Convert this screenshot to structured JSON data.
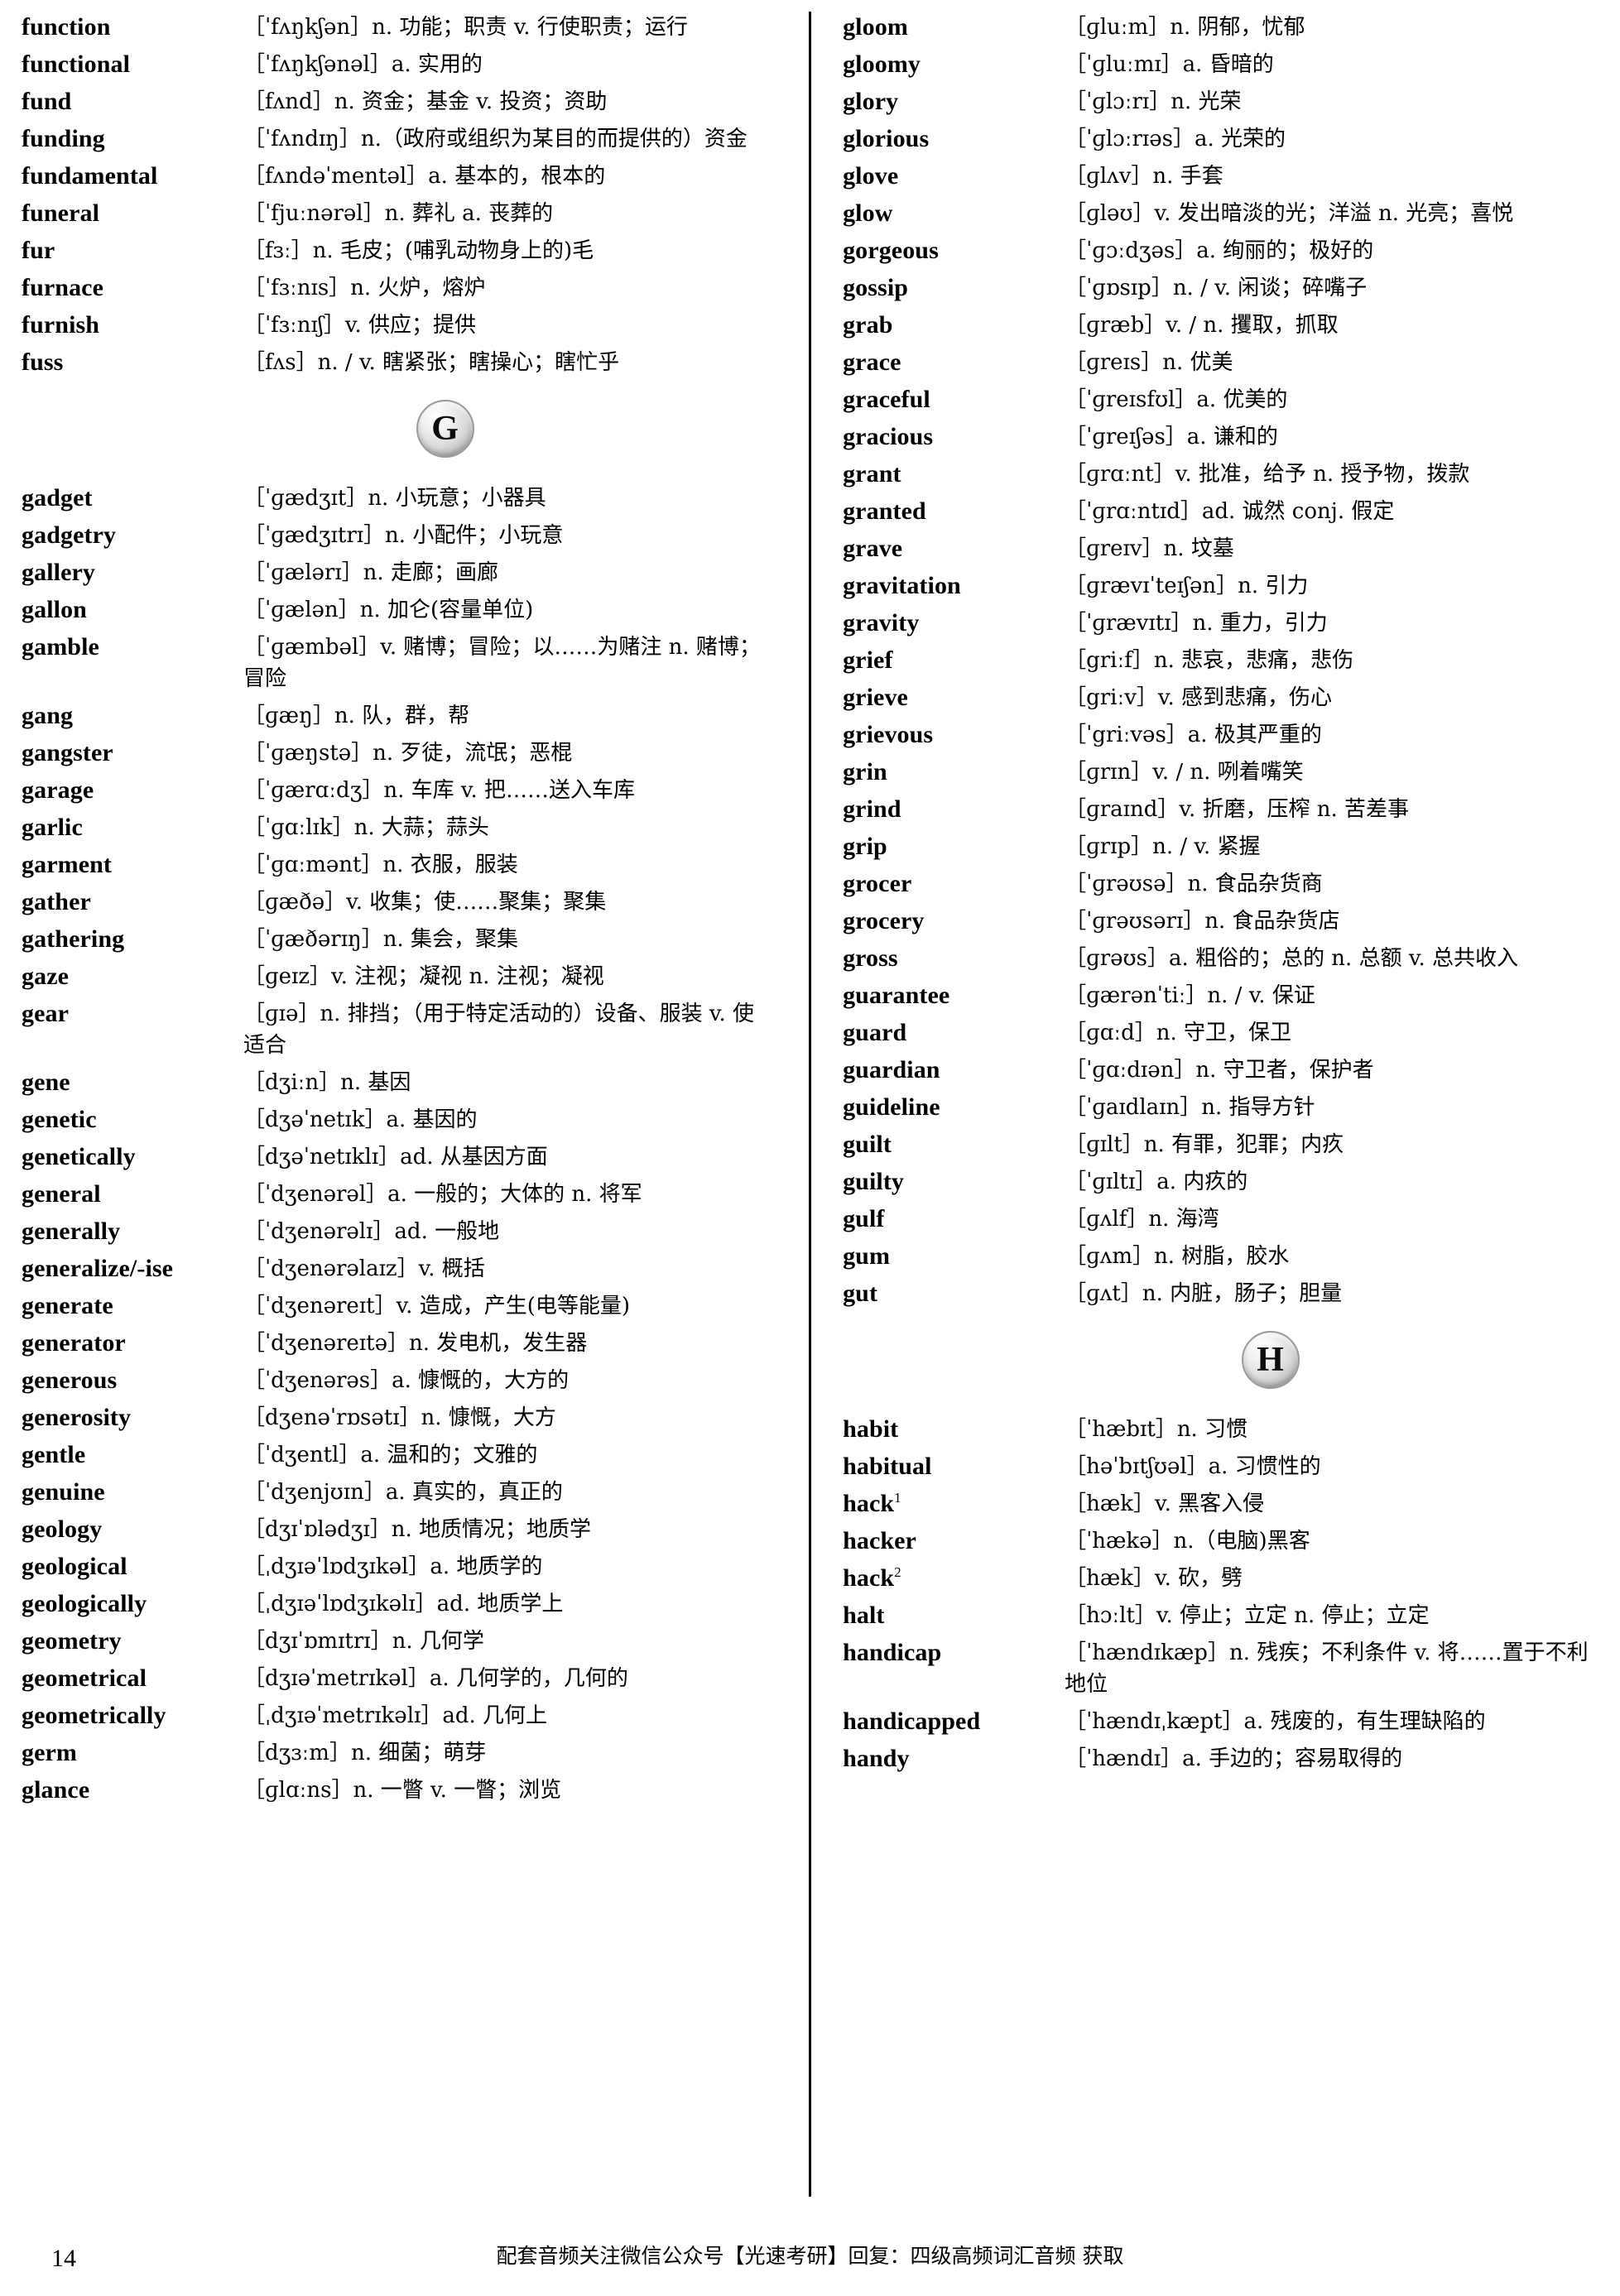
{
  "page": {
    "number": "14",
    "footer_note": "配套音频关注微信公众号【光速考研】回复：四级高频词汇音频 获取"
  },
  "left_column": {
    "entries": [
      {
        "word": "function",
        "sense": "［ˈfʌŋkʃən］n. 功能；职责 v. 行使职责；运行"
      },
      {
        "word": "functional",
        "sense": "［ˈfʌŋkʃənəl］a. 实用的"
      },
      {
        "word": "fund",
        "sense": "［fʌnd］n. 资金；基金 v. 投资；资助"
      },
      {
        "word": "funding",
        "sense": "［ˈfʌndɪŋ］n.（政府或组织为某目的而提供的）资金"
      },
      {
        "word": "fundamental",
        "sense": "［fʌndəˈmentəl］a. 基本的，根本的"
      },
      {
        "word": "funeral",
        "sense": "［ˈfjuːnərəl］n. 葬礼 a. 丧葬的"
      },
      {
        "word": "fur",
        "sense": "［fɜː］n. 毛皮；(哺乳动物身上的)毛"
      },
      {
        "word": "furnace",
        "sense": "［ˈfɜːnɪs］n. 火炉，熔炉"
      },
      {
        "word": "furnish",
        "sense": "［ˈfɜːnɪʃ］v. 供应；提供"
      },
      {
        "word": "fuss",
        "sense": "［fʌs］n. / v. 瞎紧张；瞎操心；瞎忙乎"
      }
    ],
    "letter_separator": "G",
    "entries_after": [
      {
        "word": "gadget",
        "sense": "［ˈɡædʒɪt］n. 小玩意；小器具"
      },
      {
        "word": "gadgetry",
        "sense": "［ˈɡædʒɪtrɪ］n. 小配件；小玩意"
      },
      {
        "word": "gallery",
        "sense": "［ˈɡælərɪ］n. 走廊；画廊"
      },
      {
        "word": "gallon",
        "sense": "［ˈɡælən］n. 加仑(容量单位)"
      },
      {
        "word": "gamble",
        "sense": "［ˈɡæmbəl］v. 赌博；冒险；以……为赌注 n. 赌博；冒险"
      },
      {
        "word": "gang",
        "sense": "［ɡæŋ］n. 队，群，帮"
      },
      {
        "word": "gangster",
        "sense": "［ˈɡæŋstə］n. 歹徒，流氓；恶棍"
      },
      {
        "word": "garage",
        "sense": "［ˈɡærɑːdʒ］n. 车库 v. 把……送入车库"
      },
      {
        "word": "garlic",
        "sense": "［ˈɡɑːlɪk］n. 大蒜；蒜头"
      },
      {
        "word": "garment",
        "sense": "［ˈɡɑːmənt］n. 衣服，服装"
      },
      {
        "word": "gather",
        "sense": "［ɡæðə］v. 收集；使……聚集；聚集"
      },
      {
        "word": "gathering",
        "sense": "［ˈɡæðərɪŋ］n. 集会，聚集"
      },
      {
        "word": "gaze",
        "sense": "［ɡeɪz］v. 注视；凝视 n. 注视；凝视"
      },
      {
        "word": "gear",
        "sense": "［ɡɪə］n. 排挡；（用于特定活动的）设备、服装 v. 使适合"
      },
      {
        "word": "gene",
        "sense": "［dʒiːn］n. 基因"
      },
      {
        "word": "genetic",
        "sense": "［dʒəˈnetɪk］a. 基因的"
      },
      {
        "word": "genetically",
        "sense": "［dʒəˈnetɪklɪ］ad. 从基因方面"
      },
      {
        "word": "general",
        "sense": "［ˈdʒenərəl］a. 一般的；大体的 n. 将军"
      },
      {
        "word": "generally",
        "sense": "［ˈdʒenərəlɪ］ad. 一般地"
      },
      {
        "word": "generalize/-ise",
        "sense": "［ˈdʒenərəlaɪz］v. 概括"
      },
      {
        "word": "generate",
        "sense": "［ˈdʒenəreɪt］v. 造成，产生(电等能量)"
      },
      {
        "word": "generator",
        "sense": "［ˈdʒenəreɪtə］n. 发电机，发生器"
      },
      {
        "word": "generous",
        "sense": "［ˈdʒenərəs］a. 慷慨的，大方的"
      },
      {
        "word": "generosity",
        "sense": "［dʒenəˈrɒsətɪ］n. 慷慨，大方"
      },
      {
        "word": "gentle",
        "sense": "［ˈdʒentl］a. 温和的；文雅的"
      },
      {
        "word": "genuine",
        "sense": "［ˈdʒenjʊɪn］a. 真实的，真正的"
      },
      {
        "word": "geology",
        "sense": "［dʒɪˈɒlədʒɪ］n. 地质情况；地质学"
      },
      {
        "word": "geological",
        "sense": "［ˌdʒɪəˈlɒdʒɪkəl］a. 地质学的"
      },
      {
        "word": "geologically",
        "sense": "［ˌdʒɪəˈlɒdʒɪkəlɪ］ad. 地质学上"
      },
      {
        "word": "geometry",
        "sense": "［dʒɪˈɒmɪtrɪ］n. 几何学"
      },
      {
        "word": "geometrical",
        "sense": "［dʒɪəˈmetrɪkəl］a. 几何学的，几何的"
      },
      {
        "word": "geometrically",
        "sense": "［ˌdʒɪəˈmetrɪkəlɪ］ad. 几何上"
      },
      {
        "word": "germ",
        "sense": "［dʒɜːm］n. 细菌；萌芽"
      },
      {
        "word": "glance",
        "sense": "［ɡlɑːns］n. 一瞥 v. 一瞥；浏览"
      }
    ]
  },
  "right_column": {
    "entries": [
      {
        "word": "gloom",
        "sense": "［ɡluːm］n. 阴郁，忧郁"
      },
      {
        "word": "gloomy",
        "sense": "［ˈɡluːmɪ］a. 昏暗的"
      },
      {
        "word": "glory",
        "sense": "［ˈɡlɔːrɪ］n. 光荣"
      },
      {
        "word": "glorious",
        "sense": "［ˈɡlɔːrɪəs］a. 光荣的"
      },
      {
        "word": "glove",
        "sense": "［ɡlʌv］n. 手套"
      },
      {
        "word": "glow",
        "sense": "［ɡləʊ］v. 发出暗淡的光；洋溢 n. 光亮；喜悦"
      },
      {
        "word": "gorgeous",
        "sense": "［ˈɡɔːdʒəs］a. 绚丽的；极好的"
      },
      {
        "word": "gossip",
        "sense": "［ˈɡɒsɪp］n. / v. 闲谈；碎嘴子"
      },
      {
        "word": "grab",
        "sense": "［ɡræb］v. / n. 攫取，抓取"
      },
      {
        "word": "grace",
        "sense": "［ɡreɪs］n. 优美"
      },
      {
        "word": "graceful",
        "sense": "［ˈɡreɪsfʊl］a. 优美的"
      },
      {
        "word": "gracious",
        "sense": "［ˈɡreɪʃəs］a. 谦和的"
      },
      {
        "word": "grant",
        "sense": "［ɡrɑːnt］v. 批准，给予 n. 授予物，拨款"
      },
      {
        "word": "granted",
        "sense": "［ˈɡrɑːntɪd］ad. 诚然 conj. 假定"
      },
      {
        "word": "grave",
        "sense": "［ɡreɪv］n. 坟墓"
      },
      {
        "word": "gravitation",
        "sense": "［ɡrævɪˈteɪʃən］n. 引力"
      },
      {
        "word": "gravity",
        "sense": "［ˈɡrævɪtɪ］n. 重力，引力"
      },
      {
        "word": "grief",
        "sense": "［griːf］n. 悲哀，悲痛，悲伤"
      },
      {
        "word": "grieve",
        "sense": "［griːv］v. 感到悲痛，伤心"
      },
      {
        "word": "grievous",
        "sense": "［ˈgriːvəs］a. 极其严重的"
      },
      {
        "word": "grin",
        "sense": "［ɡrɪn］v. / n. 咧着嘴笑"
      },
      {
        "word": "grind",
        "sense": "［ɡraɪnd］v. 折磨，压榨 n. 苦差事"
      },
      {
        "word": "grip",
        "sense": "［ɡrɪp］n. / v. 紧握"
      },
      {
        "word": "grocer",
        "sense": "［ˈɡrəʊsə］n. 食品杂货商"
      },
      {
        "word": "grocery",
        "sense": "［ˈɡrəʊsərɪ］n. 食品杂货店"
      },
      {
        "word": "gross",
        "sense": "［ɡrəʊs］a. 粗俗的；总的 n. 总额 v. 总共收入"
      },
      {
        "word": "guarantee",
        "sense": "［ɡærənˈtiː］n. / v. 保证"
      },
      {
        "word": "guard",
        "sense": "［ɡɑːd］n. 守卫，保卫"
      },
      {
        "word": "guardian",
        "sense": "［ˈɡɑːdɪən］n. 守卫者，保护者"
      },
      {
        "word": "guideline",
        "sense": "［ˈɡaɪdlaɪn］n. 指导方针"
      },
      {
        "word": "guilt",
        "sense": "［ɡɪlt］n. 有罪，犯罪；内疚"
      },
      {
        "word": "guilty",
        "sense": "［ˈɡɪltɪ］a. 内疚的"
      },
      {
        "word": "gulf",
        "sense": "［ɡʌlf］n. 海湾"
      },
      {
        "word": "gum",
        "sense": "［ɡʌm］n. 树脂，胶水"
      },
      {
        "word": "gut",
        "sense": "［ɡʌt］n. 内脏，肠子；胆量"
      }
    ],
    "letter_separator": "H",
    "entries_after": [
      {
        "word": "habit",
        "sense": "［ˈhæbɪt］n. 习惯"
      },
      {
        "word": "habitual",
        "sense": "［həˈbɪtʃʊəl］a. 习惯性的"
      },
      {
        "word": "hack",
        "sup": "1",
        "sense": "［hæk］v. 黑客入侵"
      },
      {
        "word": "hacker",
        "sense": "［ˈhækə］n.（电脑)黑客"
      },
      {
        "word": "hack",
        "sup": "2",
        "sense": "［hæk］v. 砍，劈"
      },
      {
        "word": "halt",
        "sense": "［hɔːlt］v. 停止；立定 n. 停止；立定"
      },
      {
        "word": "handicap",
        "sense": "［ˈhændɪkæp］n. 残疾；不利条件 v. 将……置于不利地位"
      },
      {
        "word": "handicapped",
        "sense": "［ˈhændɪˌkæpt］a. 残废的，有生理缺陷的"
      },
      {
        "word": "handy",
        "sense": "［ˈhændɪ］a. 手边的；容易取得的"
      }
    ]
  }
}
